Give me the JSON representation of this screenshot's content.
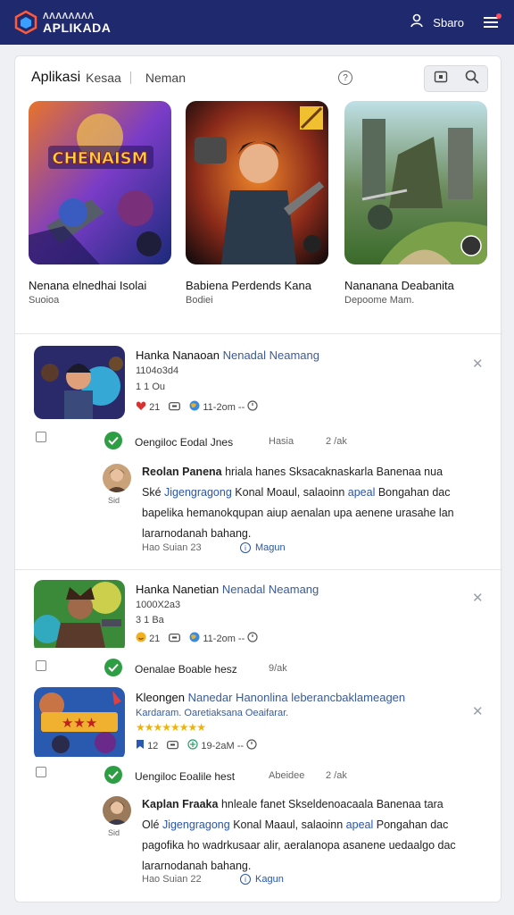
{
  "header": {
    "logo_line1": "ΛΛΛΛΛΛΛΛ",
    "logo_line2": "APLIKADA",
    "user_label": "Sbaro"
  },
  "tabs": {
    "active": "Aplikasi",
    "items": [
      "Kesaa",
      "Neman"
    ]
  },
  "featured": [
    {
      "title": "Nenana elnedhai Isolai",
      "subtitle": "Suoioa",
      "art_text": "CHENAISM"
    },
    {
      "title": "Babiena Perdends Kana",
      "subtitle": "Bodiei"
    },
    {
      "title": "Nananana Deabanita",
      "subtitle": "Depoome Mam."
    }
  ],
  "posts": [
    {
      "title": "Hanka Nanaoan",
      "title_accent": "Nenadal Neamang",
      "meta1": "1104o3d4",
      "meta2": "1 1 Ou",
      "stat1": "21",
      "stat3": "11-2om --",
      "tag_title": "Oengiloc Eodal Jnes",
      "tag_mid": "Hasia",
      "tag_right": "2 /ak",
      "comment": {
        "author": "Reolan Panena",
        "line1_rest": "hriala hanes Sksacaknaskarla Banenaa nua",
        "line2_start": "Ské",
        "line2_link": "Jigengragong",
        "line2_mid": "Konal Moaul, salaoinn",
        "line2_link2": "apeal",
        "line2_end": "Bongahan dac",
        "line3": "bapelika hemanokqupan aiup aenalan upa aenene urasahe lan",
        "line4": "lararnodanah bahang.",
        "avatar_label": "Sid",
        "date": "Hao Suian 23",
        "link": "Magun"
      }
    },
    {
      "title": "Hanka Nanetian",
      "title_accent": "Nenadal Neamang",
      "meta1": "1000X2a3",
      "meta2": "3 1 Ba",
      "stat1": "21",
      "stat3": "11-2om --",
      "tag_title": "Oenalae Boable hesz",
      "tag_mid": "",
      "tag_right": "9/ak"
    },
    {
      "title": "Kleongen",
      "title_accent": "Nanedar Hanonlina leberancbaklameagen",
      "meta1": "Kardaram. Oaretiaksana Oeaifarar.",
      "stars": "★★★★★★★★",
      "stat1": "12",
      "stat3": "19-2aM --",
      "tag_title": "Uengiloc Eoalile hest",
      "tag_mid": "Abeidee",
      "tag_right": "2 /ak",
      "comment": {
        "author": "Kaplan Fraaka",
        "line1_rest": "hnleale fanet Skseldenoacaala Banenaa tara",
        "line2_start": "Olé",
        "line2_link": "Jigengragong",
        "line2_mid": "Konal Maaul, salaoinn",
        "line2_link2": "apeal",
        "line2_end": "Pongahan dac",
        "line3": "pagofika ho wadrkusaar alir, aeralanopa asanene uedaalgo dac",
        "line4": "lararnodanah bahang.",
        "avatar_label": "Sid",
        "date": "Hao Suian 22",
        "link": "Kagun"
      }
    }
  ]
}
